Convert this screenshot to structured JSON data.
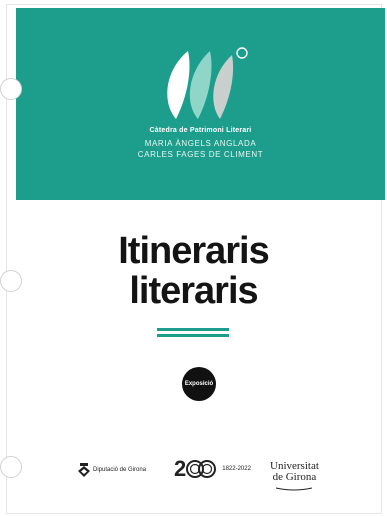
{
  "header": {
    "chair_name": "Càtedra de Patrimoni Literari",
    "person_1": "MARIA ÀNGELS ANGLADA",
    "person_2": "CARLES FAGES DE CLIMENT",
    "logo_icon": "three-trees-logo-icon"
  },
  "title": {
    "line_1": "Itineraris",
    "line_2": "literaris"
  },
  "badge": {
    "label": "Exposició"
  },
  "footer": {
    "diputacio": "Diputació de Girona",
    "anniversary_number": "2",
    "anniversary_years": "1822-2022",
    "udg_line_1": "Universitat",
    "udg_line_2": "de Girona"
  },
  "colors": {
    "brand_teal": "#1d9e8d",
    "text_dark": "#141414",
    "badge_black": "#111111"
  }
}
